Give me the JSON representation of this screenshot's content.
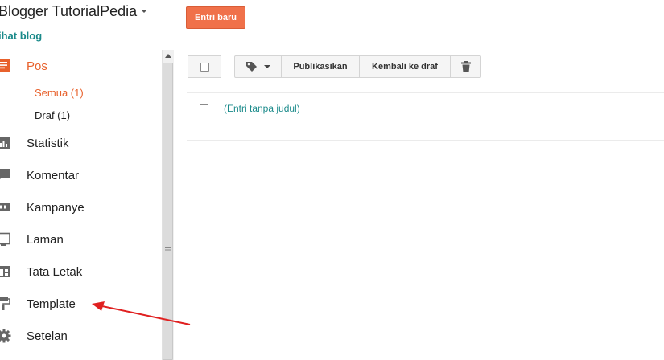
{
  "header": {
    "blog_title": "Blogger TutorialPedia",
    "view_blog": "ihat blog",
    "new_post_button": "Entri baru"
  },
  "sidebar": {
    "items": [
      {
        "label": "Pos",
        "icon": "posts-icon",
        "active": true
      },
      {
        "label": "Statistik",
        "icon": "stats-icon"
      },
      {
        "label": "Komentar",
        "icon": "comment-icon"
      },
      {
        "label": "Kampanye",
        "icon": "ad-icon"
      },
      {
        "label": "Laman",
        "icon": "pages-icon"
      },
      {
        "label": "Tata Letak",
        "icon": "layout-icon"
      },
      {
        "label": "Template",
        "icon": "paint-roller-icon"
      },
      {
        "label": "Setelan",
        "icon": "gear-icon"
      }
    ],
    "subitems": [
      {
        "label": "Semua (1)",
        "active": true
      },
      {
        "label": "Draf (1)"
      }
    ]
  },
  "toolbar": {
    "label_icon": "tag-icon",
    "publish": "Publikasikan",
    "revert_to_draft": "Kembali ke draf",
    "delete_icon": "trash-icon"
  },
  "posts": [
    {
      "title": "(Entri tanpa judul)"
    }
  ],
  "colors": {
    "accent": "#f0714a",
    "active_text": "#e8612c",
    "link": "#1a8a8a",
    "annotation_arrow": "#e02020"
  }
}
